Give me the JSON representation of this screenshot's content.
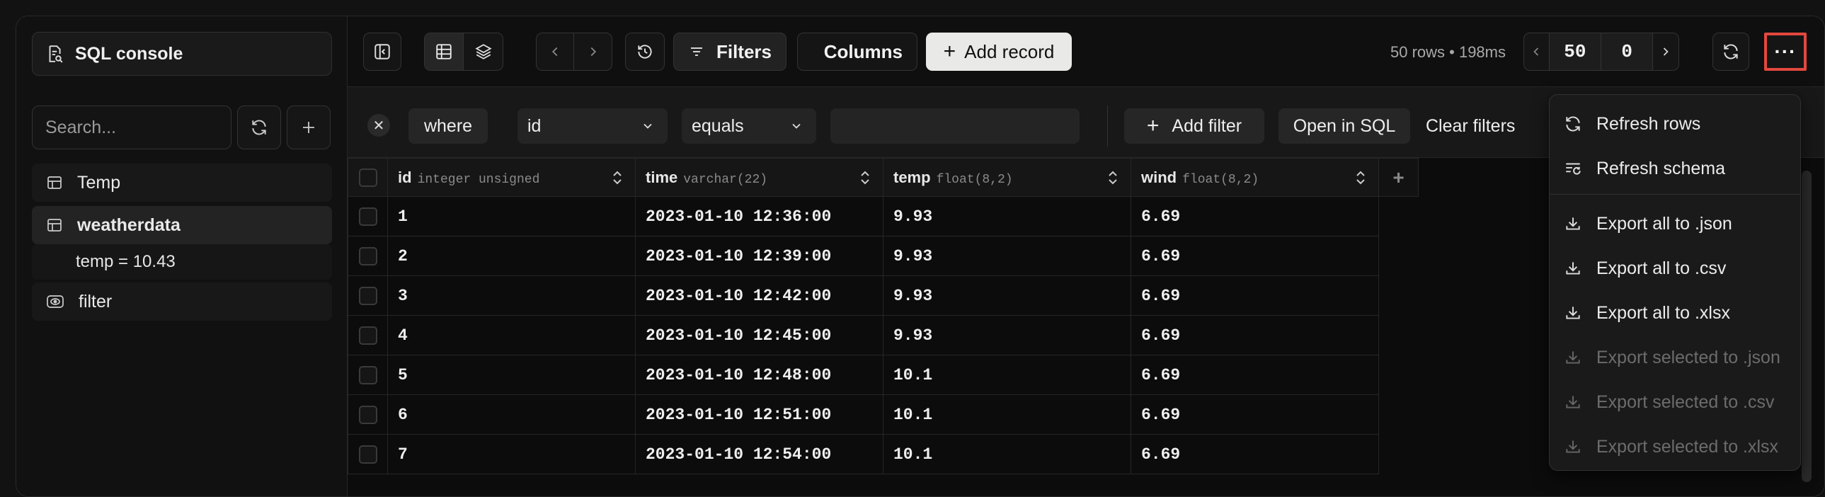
{
  "sidebar": {
    "console_label": "SQL console",
    "search_placeholder": "Search...",
    "items": [
      {
        "label": "Temp"
      },
      {
        "label": "weatherdata",
        "sub": "temp = 10.43"
      },
      {
        "label": "filter"
      }
    ]
  },
  "toolbar": {
    "filters_label": "Filters",
    "columns_label": "Columns",
    "add_record_label": "Add record",
    "rows_info": "50 rows • 198ms",
    "limit": "50",
    "offset": "0",
    "more_label": "···"
  },
  "filter": {
    "where_label": "where",
    "column": "id",
    "operator": "equals",
    "value": "",
    "add_filter_label": "Add filter",
    "open_sql_label": "Open in SQL",
    "clear_label": "Clear filters"
  },
  "table": {
    "columns": [
      {
        "name": "id",
        "type": "integer unsigned"
      },
      {
        "name": "time",
        "type": "varchar(22)"
      },
      {
        "name": "temp",
        "type": "float(8,2)"
      },
      {
        "name": "wind",
        "type": "float(8,2)"
      }
    ],
    "rows": [
      [
        "1",
        "2023-01-10 12:36:00",
        "9.93",
        "6.69"
      ],
      [
        "2",
        "2023-01-10 12:39:00",
        "9.93",
        "6.69"
      ],
      [
        "3",
        "2023-01-10 12:42:00",
        "9.93",
        "6.69"
      ],
      [
        "4",
        "2023-01-10 12:45:00",
        "9.93",
        "6.69"
      ],
      [
        "5",
        "2023-01-10 12:48:00",
        "10.1",
        "6.69"
      ],
      [
        "6",
        "2023-01-10 12:51:00",
        "10.1",
        "6.69"
      ],
      [
        "7",
        "2023-01-10 12:54:00",
        "10.1",
        "6.69"
      ]
    ]
  },
  "menu": {
    "refresh_rows": "Refresh rows",
    "refresh_schema": "Refresh schema",
    "export_json": "Export all to .json",
    "export_csv": "Export all to .csv",
    "export_xlsx": "Export all to .xlsx",
    "export_sel_json": "Export selected to .json",
    "export_sel_csv": "Export selected to .csv",
    "export_sel_xlsx": "Export selected to .xlsx"
  },
  "colors": {
    "accent_outline": "#e2483f",
    "add_record_bg": "#e9e9e7"
  }
}
